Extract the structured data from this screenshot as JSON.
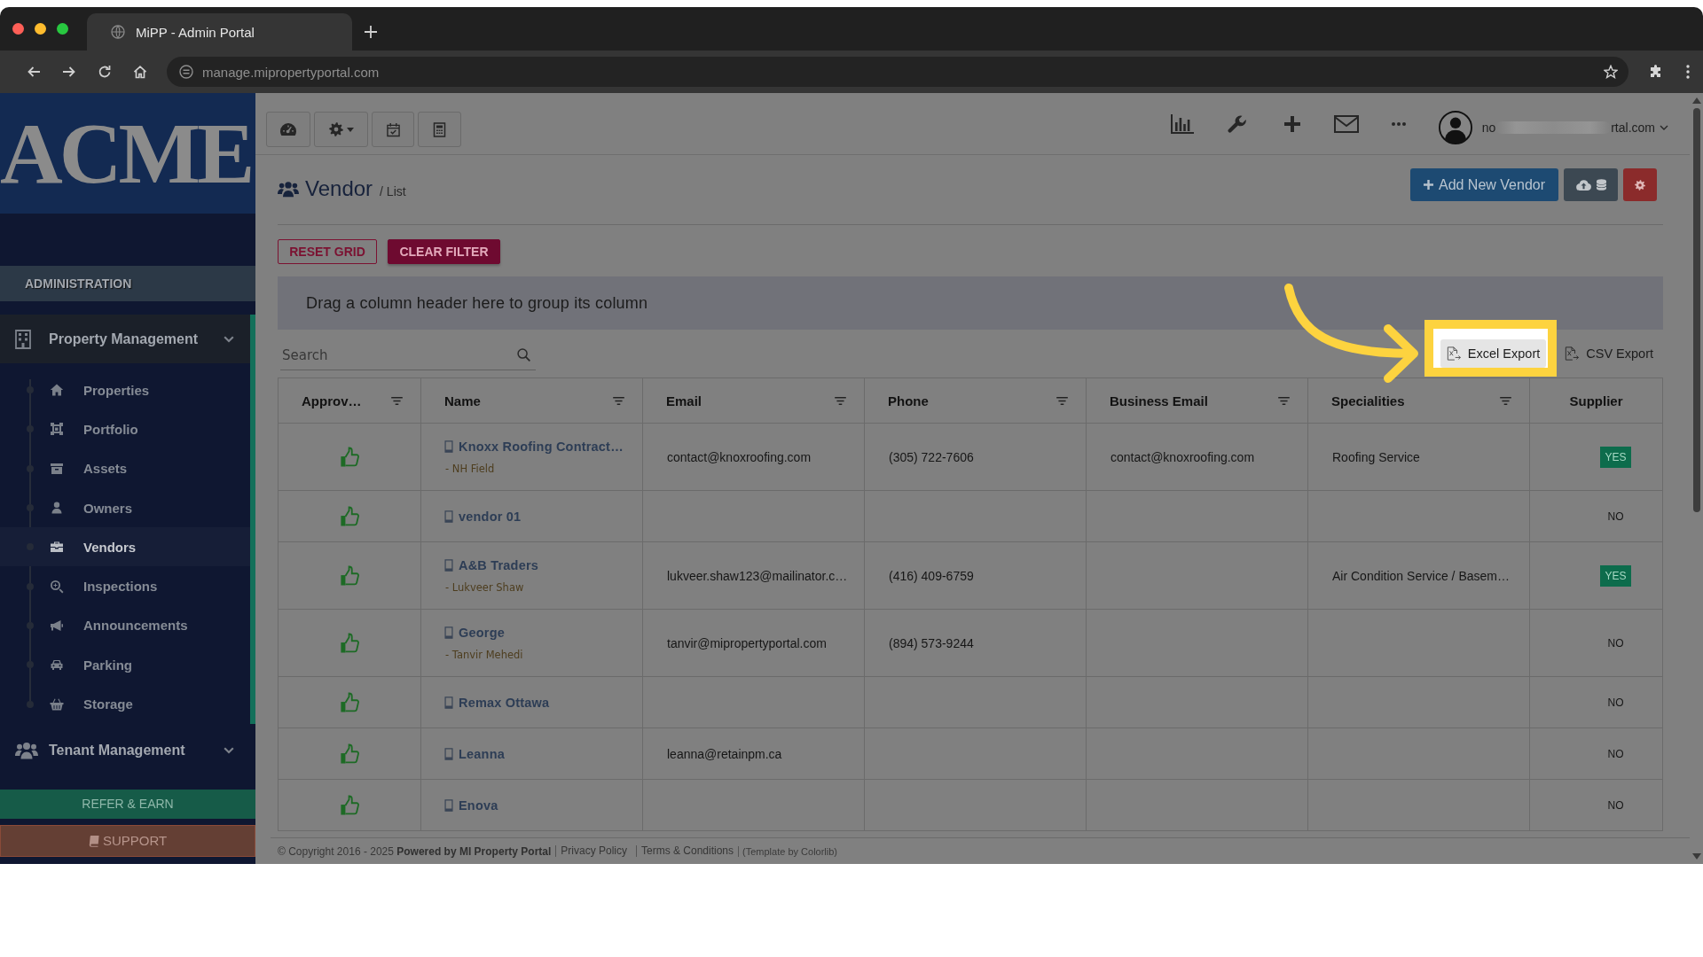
{
  "browser": {
    "tab_title": "MiPP - Admin Portal",
    "url": "manage.mipropertyportal.com"
  },
  "sidebar": {
    "logo": "ACME",
    "section": "ADMINISTRATION",
    "groups": [
      {
        "label": "Property Management",
        "selected": true,
        "children": [
          {
            "label": "Properties",
            "selected": false
          },
          {
            "label": "Portfolio",
            "selected": false
          },
          {
            "label": "Assets",
            "selected": false
          },
          {
            "label": "Owners",
            "selected": false
          },
          {
            "label": "Vendors",
            "selected": true
          },
          {
            "label": "Inspections",
            "selected": false
          },
          {
            "label": "Announcements",
            "selected": false
          },
          {
            "label": "Parking",
            "selected": false
          },
          {
            "label": "Storage",
            "selected": false
          }
        ]
      },
      {
        "label": "Tenant Management",
        "selected": false
      }
    ],
    "buttons": [
      {
        "label": "REFER & EARN",
        "kind": "refer"
      },
      {
        "label": "SUPPORT",
        "kind": "support"
      }
    ]
  },
  "user_menu": {
    "label_start": "no",
    "label_end": "rtal.com"
  },
  "page": {
    "title": "Vendor",
    "breadcrumb": "/ List",
    "actions": [
      {
        "label": "Add New Vendor",
        "kind": "primary"
      }
    ]
  },
  "grid": {
    "buttons": [
      {
        "label": "RESET GRID",
        "kind": "outline"
      },
      {
        "label": "CLEAR FILTER",
        "kind": "filled"
      }
    ],
    "group_panel": "Drag a column header here to group its column",
    "search": {
      "placeholder": "Search"
    },
    "exports": [
      {
        "label": "Excel Export",
        "highlighted": true
      },
      {
        "label": "CSV Export",
        "highlighted": false
      }
    ],
    "columns": [
      {
        "label": "Approv…",
        "filterable": true
      },
      {
        "label": "Name",
        "filterable": true
      },
      {
        "label": "Email",
        "filterable": true
      },
      {
        "label": "Phone",
        "filterable": true
      },
      {
        "label": "Business Email",
        "filterable": true
      },
      {
        "label": "Specialities",
        "filterable": true
      },
      {
        "label": "Supplier",
        "filterable": false
      }
    ],
    "rows": [
      {
        "approved": true,
        "name": "Knoxx Roofing Contract…",
        "contact": "- NH Field",
        "email": "contact@knoxroofing.com",
        "phone": "(305) 722-7606",
        "business_email": "contact@knoxroofing.com",
        "specialities": "Roofing Service",
        "supplier": {
          "label": "YES",
          "on": true
        }
      },
      {
        "approved": true,
        "name": "vendor 01",
        "supplier": {
          "label": "NO",
          "on": false
        }
      },
      {
        "approved": true,
        "name": "A&B Traders",
        "contact": "- Lukveer Shaw",
        "email": "lukveer.shaw123@mailinator.c…",
        "phone": "(416) 409-6759",
        "specialities": "Air Condition Service / Basem…",
        "supplier": {
          "label": "YES",
          "on": true
        }
      },
      {
        "approved": true,
        "name": "George",
        "contact": "- Tanvir Mehedi",
        "email": "tanvir@mipropertyportal.com",
        "phone": "(894) 573-9244",
        "supplier": {
          "label": "NO",
          "on": false
        }
      },
      {
        "approved": true,
        "name": "Remax Ottawa",
        "supplier": {
          "label": "NO",
          "on": false
        }
      },
      {
        "approved": true,
        "name": "Leanna",
        "email": "leanna@retainpm.ca",
        "supplier": {
          "label": "NO",
          "on": false
        }
      },
      {
        "approved": true,
        "name": "Enova",
        "supplier": {
          "label": "NO",
          "on": false
        }
      }
    ]
  },
  "footer": {
    "copyright": "© Copyright 2016 - 2025 **Powered by MI Property Portal**",
    "links": [
      "Privacy Policy",
      "Terms & Conditions"
    ],
    "credit": "(Template by Colorlib)"
  }
}
